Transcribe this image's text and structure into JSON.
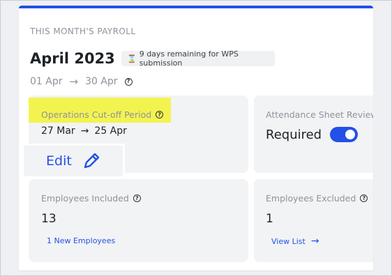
{
  "payroll": {
    "section_label": "THIS MONTH'S PAYROLL",
    "month_title": "April 2023",
    "wps_notice": "9 days remaining for WPS submission",
    "period_start": "01 Apr",
    "period_end": "30 Apr"
  },
  "cutoff": {
    "label": "Operations Cut-off Period",
    "start": "27 Mar",
    "end": "25 Apr",
    "edit_label": "Edit"
  },
  "attendance": {
    "label": "Attendance Sheet Review",
    "status": "Required",
    "toggle_on": true
  },
  "employees_included": {
    "label": "Employees Included",
    "count": "13",
    "link": "1 New Employees"
  },
  "employees_excluded": {
    "label": "Employees Excluded",
    "count": "1",
    "link": "View List"
  },
  "icons": {
    "hourglass": "hourglass-icon",
    "help": "help-circle-icon",
    "arrow_right": "arrow-right-icon",
    "pencil": "pencil-icon"
  },
  "colors": {
    "accent": "#2350e6",
    "highlight": "#f3f350",
    "tile_bg": "#f2f3f5"
  }
}
